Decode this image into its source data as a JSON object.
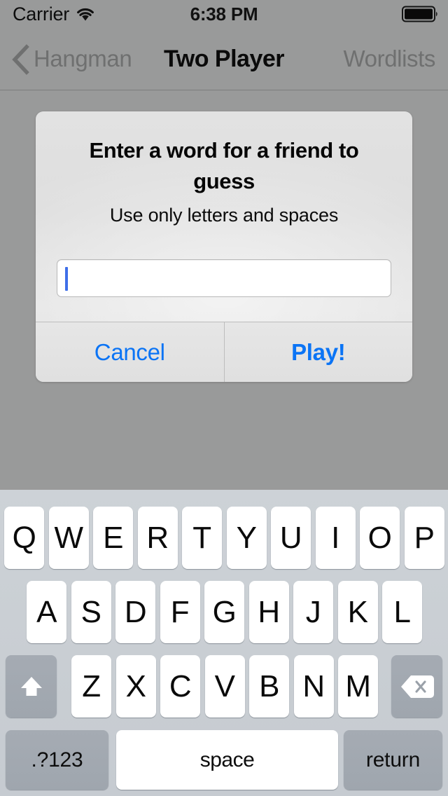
{
  "status_bar": {
    "carrier": "Carrier",
    "wifi_icon": "wifi-icon",
    "time": "6:38 PM",
    "battery_icon": "battery-full-icon"
  },
  "nav_bar": {
    "back_icon": "chevron-left-icon",
    "back_label": "Hangman",
    "title": "Two Player",
    "right_label": "Wordlists"
  },
  "alert": {
    "title": "Enter a word for a friend to guess",
    "message": "Use only letters and spaces",
    "input_value": "",
    "input_placeholder": "",
    "cancel_label": "Cancel",
    "confirm_label": "Play!"
  },
  "keyboard": {
    "row1": [
      "Q",
      "W",
      "E",
      "R",
      "T",
      "Y",
      "U",
      "I",
      "O",
      "P"
    ],
    "row2": [
      "A",
      "S",
      "D",
      "F",
      "G",
      "H",
      "J",
      "K",
      "L"
    ],
    "row3": [
      "Z",
      "X",
      "C",
      "V",
      "B",
      "N",
      "M"
    ],
    "shift_icon": "shift-arrow-up-icon",
    "delete_icon": "delete-backspace-icon",
    "numeric_label": ".?123",
    "space_label": "space",
    "return_label": "return"
  },
  "colors": {
    "accent_blue": "#0b74f5",
    "caret_blue": "#3f6fe8",
    "backdrop_gray": "#999a9a",
    "keyboard_bg": "#cbd0d6",
    "key_white": "#ffffff",
    "key_dark": "#a2a9b1",
    "alert_bg": "#e1e1e1"
  }
}
